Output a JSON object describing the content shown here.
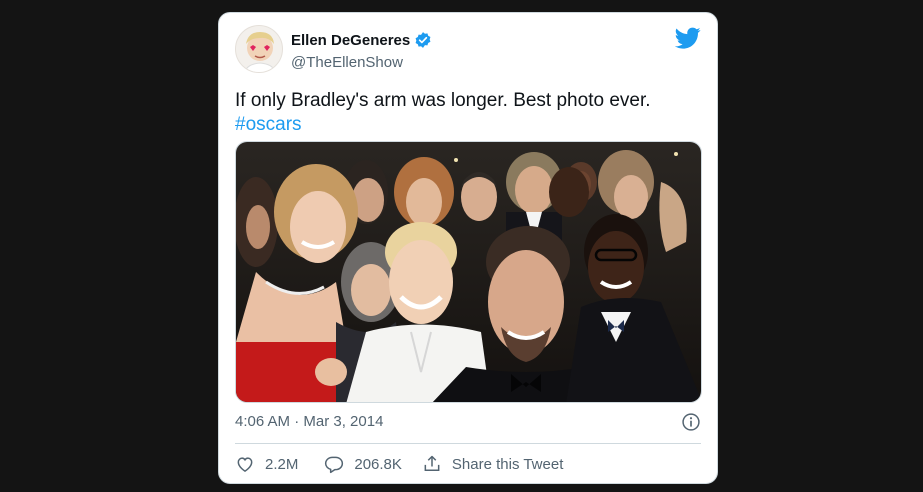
{
  "tweet": {
    "author_name": "Ellen DeGeneres",
    "handle": "@TheEllenShow",
    "text": "If only Bradley's arm was longer. Best photo ever.",
    "hashtag": "#oscars",
    "timestamp": "4:06 AM · Mar 3, 2014",
    "likes": "2.2M",
    "replies": "206.8K",
    "share_label": "Share this Tweet"
  },
  "icons": {
    "verified": "verified-badge-icon",
    "brand": "twitter-bird-icon",
    "info": "info-icon",
    "like": "heart-icon",
    "reply": "reply-bubble-icon",
    "share": "share-icon"
  },
  "colors": {
    "accent": "#1d9bf0",
    "text": "#0f1419",
    "muted": "#536471",
    "page_background": "#141414"
  }
}
